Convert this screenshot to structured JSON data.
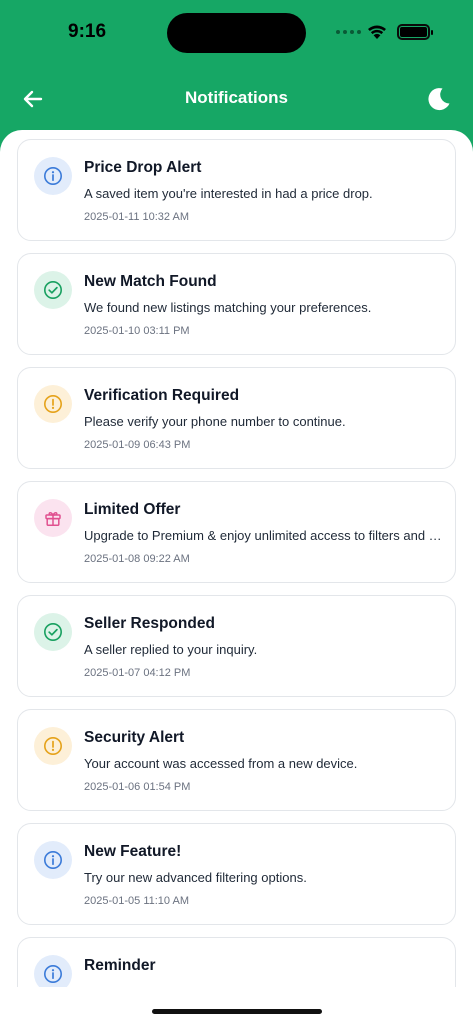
{
  "status_bar": {
    "time": "9:16"
  },
  "header": {
    "title": "Notifications",
    "accent_color": "#16a765"
  },
  "notifications": [
    {
      "type": "info",
      "icon": "info-icon",
      "title": "Price Drop Alert",
      "message": "A saved item you're interested in had a price drop.",
      "timestamp": "2025-01-11 10:32 AM"
    },
    {
      "type": "success",
      "icon": "check-circle-icon",
      "title": "New Match Found",
      "message": "We found new listings matching your preferences.",
      "timestamp": "2025-01-10 03:11 PM"
    },
    {
      "type": "warning",
      "icon": "alert-circle-icon",
      "title": "Verification Required",
      "message": "Please verify your phone number to continue.",
      "timestamp": "2025-01-09 06:43 PM"
    },
    {
      "type": "promo",
      "icon": "gift-icon",
      "title": "Limited Offer",
      "message": "Upgrade to Premium & enjoy unlimited access to filters and more.",
      "timestamp": "2025-01-08 09:22 AM"
    },
    {
      "type": "success",
      "icon": "check-circle-icon",
      "title": "Seller Responded",
      "message": "A seller replied to your inquiry.",
      "timestamp": "2025-01-07 04:12 PM"
    },
    {
      "type": "warning",
      "icon": "alert-circle-icon",
      "title": "Security Alert",
      "message": "Your account was accessed from a new device.",
      "timestamp": "2025-01-06 01:54 PM"
    },
    {
      "type": "info",
      "icon": "info-icon",
      "title": "New Feature!",
      "message": "Try our new advanced filtering options.",
      "timestamp": "2025-01-05 11:10 AM"
    },
    {
      "type": "info",
      "icon": "info-icon",
      "title": "Reminder",
      "message": "",
      "timestamp": ""
    }
  ],
  "type_colors": {
    "info": {
      "bg": "#e2ecfb",
      "fg": "#3b7bd9"
    },
    "success": {
      "bg": "#dcf3e8",
      "fg": "#18a060"
    },
    "warning": {
      "bg": "#fdf0d8",
      "fg": "#e5a21a"
    },
    "promo": {
      "bg": "#fbe3ef",
      "fg": "#e0508f"
    }
  }
}
